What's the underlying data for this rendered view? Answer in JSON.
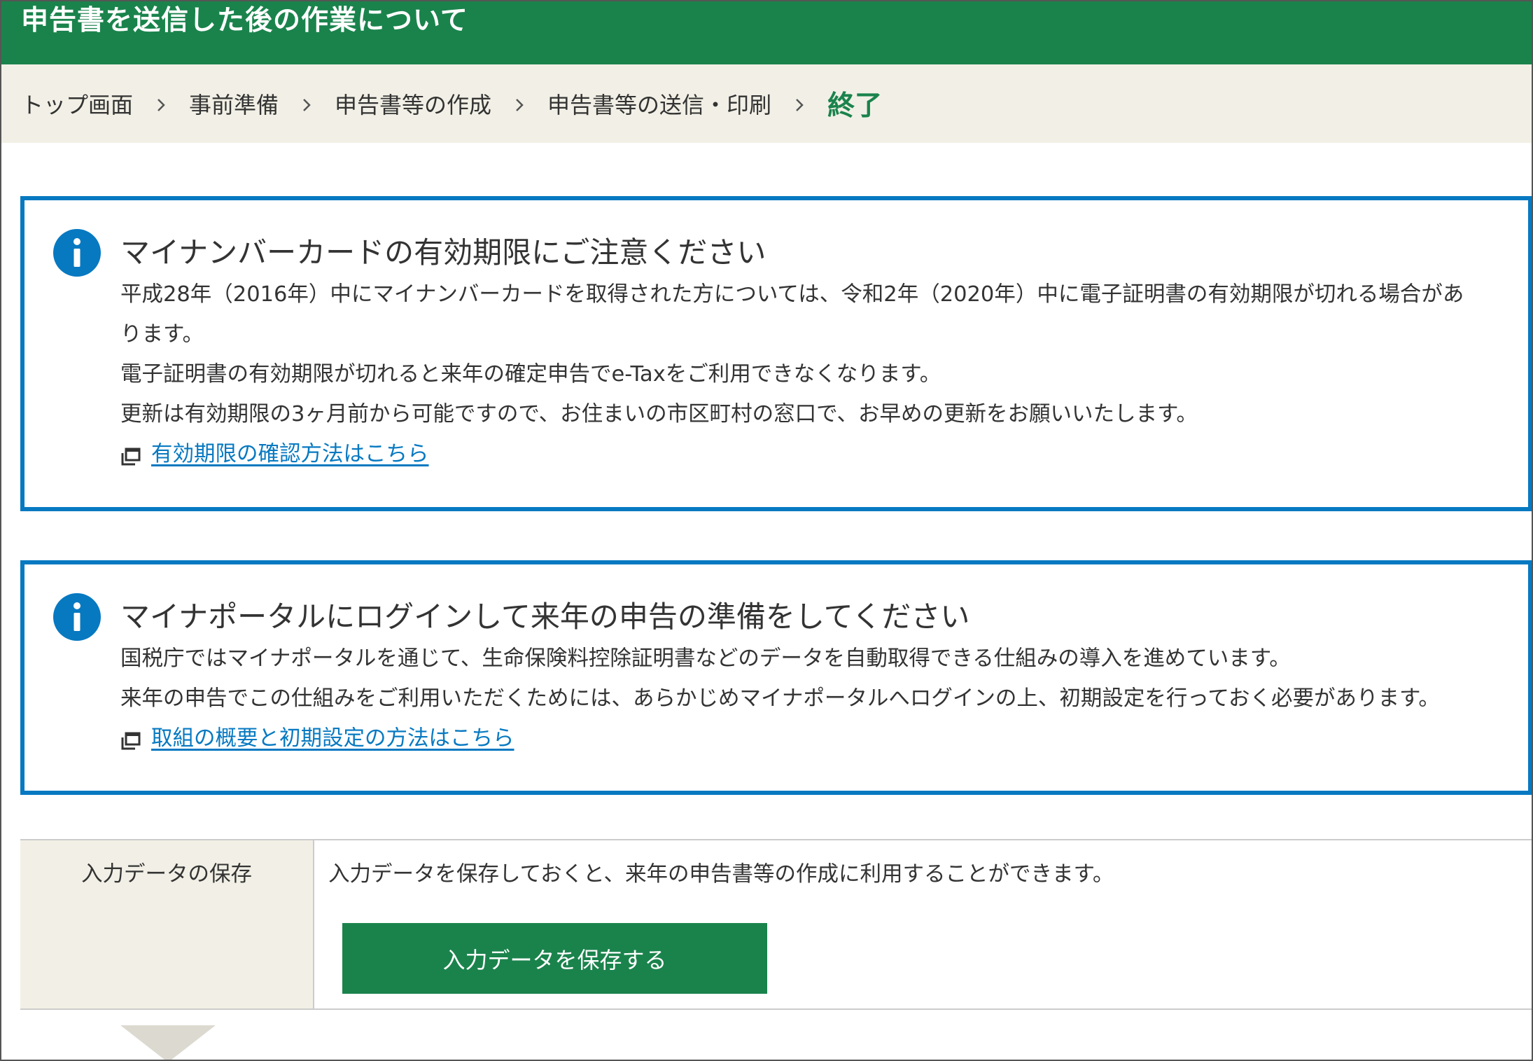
{
  "header": {
    "title": "申告書を送信した後の作業について"
  },
  "breadcrumb": {
    "items": [
      "トップ画面",
      "事前準備",
      "申告書等の作成",
      "申告書等の送信・印刷"
    ],
    "current": "終了"
  },
  "notices": [
    {
      "title": "マイナンバーカードの有効期限にご注意ください",
      "lines": [
        "平成28年（2016年）中にマイナンバーカードを取得された方については、令和2年（2020年）中に電子証明書の有効期限が切れる場合があ",
        "ります。",
        "電子証明書の有効期限が切れると来年の確定申告でe-Taxをご利用できなくなります。",
        "更新は有効期限の3ヶ月前から可能ですので、お住まいの市区町村の窓口で、お早めの更新をお願いいたします。"
      ],
      "link": "有効期限の確認方法はこちら"
    },
    {
      "title": "マイナポータルにログインして来年の申告の準備をしてください",
      "lines": [
        "国税庁ではマイナポータルを通じて、生命保険料控除証明書などのデータを自動取得できる仕組みの導入を進めています。",
        "来年の申告でこの仕組みをご利用いただくためには、あらかじめマイナポータルへログインの上、初期設定を行っておく必要があります。"
      ],
      "link": "取組の概要と初期設定の方法はこちら"
    }
  ],
  "save_section": {
    "heading": "入力データの保存",
    "description": "入力データを保存しておくと、来年の申告書等の作成に利用することができます。",
    "button_label": "入力データを保存する"
  },
  "icons": {
    "info": "info-circle-icon",
    "external_link": "external-window-icon",
    "chevron": "chevron-right-icon",
    "flow_arrow": "down-triangle-icon"
  },
  "colors": {
    "header_bg": "#1a834c",
    "breadcrumb_bg": "#f2f0e6",
    "notice_border": "#0779c1",
    "link": "#0779c1",
    "button_bg": "#1a834c"
  }
}
